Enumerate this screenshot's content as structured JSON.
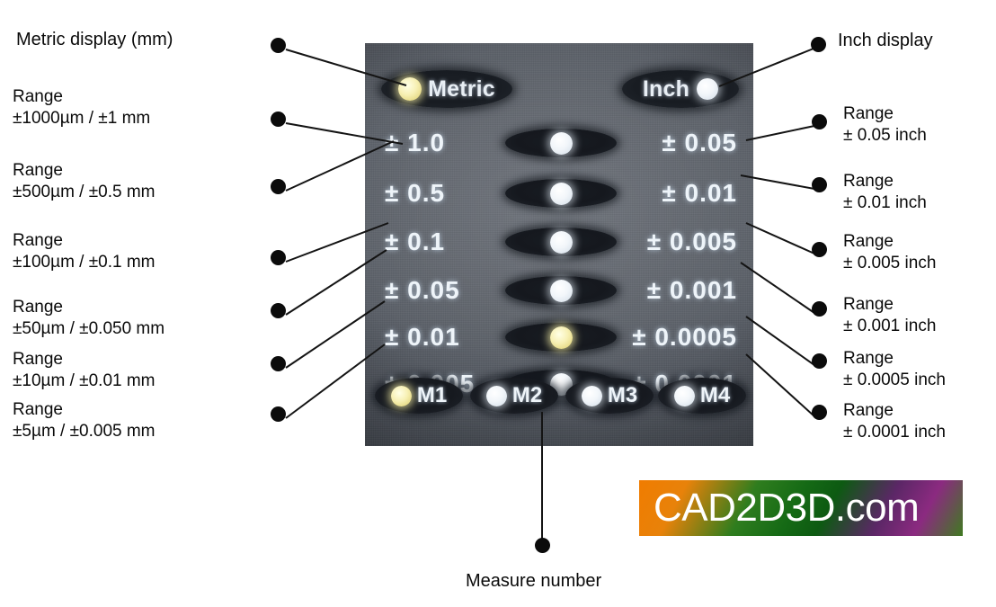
{
  "device": {
    "header": {
      "metric": {
        "label": "Metric",
        "led_state": "on",
        "led_color": "#f5ee9f"
      },
      "inch": {
        "label": "Inch",
        "led_state": "white",
        "led_color": "#f2f6fa"
      }
    },
    "rows": [
      {
        "metric": "± 1.0",
        "inch": "± 0.05",
        "led": "white"
      },
      {
        "metric": "± 0.5",
        "inch": "± 0.01",
        "led": "white"
      },
      {
        "metric": "± 0.1",
        "inch": "± 0.005",
        "led": "white"
      },
      {
        "metric": "± 0.05",
        "inch": "± 0.001",
        "led": "white"
      },
      {
        "metric": "± 0.01",
        "inch": "± 0.0005",
        "led": "on"
      },
      {
        "metric": "± 0.005",
        "inch": "± 0.0001",
        "led": "white"
      }
    ],
    "memory_buttons": [
      {
        "label": "M1",
        "led": "on"
      },
      {
        "label": "M2",
        "led": "white"
      },
      {
        "label": "M3",
        "led": "white"
      },
      {
        "label": "M4",
        "led": "white"
      }
    ]
  },
  "annotations": {
    "left": {
      "title": "Metric display (mm)",
      "range_word": "Range",
      "ranges": [
        "±1000µm / ±1 mm",
        "±500µm / ±0.5 mm",
        "±100µm / ±0.1 mm",
        "±50µm / ±0.050 mm",
        "±10µm / ±0.01 mm",
        "±5µm / ±0.005 mm"
      ]
    },
    "right": {
      "title": "Inch display",
      "range_word": "Range",
      "ranges": [
        "± 0.05 inch",
        "± 0.01 inch",
        "± 0.005 inch",
        "± 0.001 inch",
        "± 0.0005 inch",
        "± 0.0001 inch"
      ]
    },
    "bottom": {
      "label": "Measure number"
    }
  },
  "watermark": {
    "text": "CAD2D3D.com"
  }
}
